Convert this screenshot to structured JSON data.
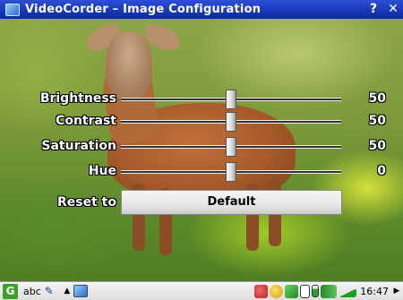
{
  "window": {
    "title": "VideoCorder – Image Configuration",
    "help_label": "?",
    "close_label": "✕"
  },
  "sliders": [
    {
      "label": "Brightness",
      "value": "50",
      "level": 0.5
    },
    {
      "label": "Contrast",
      "value": "50",
      "level": 0.5
    },
    {
      "label": "Saturation",
      "value": "50",
      "level": 0.5
    },
    {
      "label": "Hue",
      "value": "0",
      "level": 0.5
    }
  ],
  "reset": {
    "label": "Reset to",
    "button_label": "Default"
  },
  "taskbar": {
    "start_icon": "G",
    "keyboard_text": "abc",
    "pen_icon": "pen-icon",
    "up_arrow": "▲",
    "clock": "16:47",
    "scroll_arrow": "▶"
  }
}
